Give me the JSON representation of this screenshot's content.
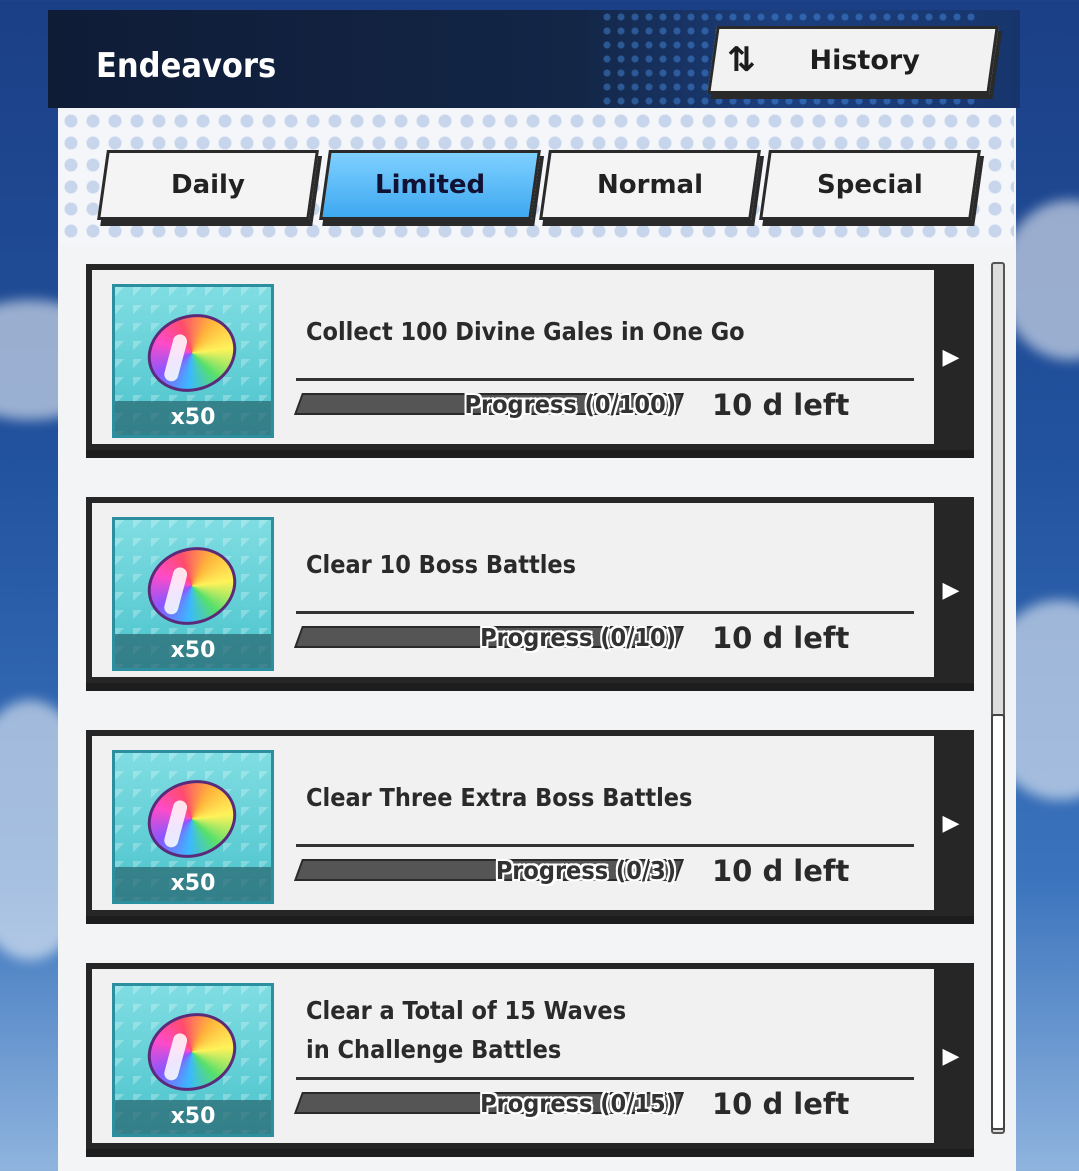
{
  "header": {
    "title": "Endeavors",
    "history_label": "History"
  },
  "tabs": [
    {
      "label": "Daily",
      "active": false
    },
    {
      "label": "Limited",
      "active": true
    },
    {
      "label": "Normal",
      "active": false
    },
    {
      "label": "Special",
      "active": false
    }
  ],
  "tasks": [
    {
      "title_lines": [
        "Collect 100 Divine Gales in One Go"
      ],
      "reward_qty": "x50",
      "progress_text": "Progress (0/100)",
      "progress": 0,
      "time_left": "10 d left"
    },
    {
      "title_lines": [
        "Clear 10 Boss Battles"
      ],
      "reward_qty": "x50",
      "progress_text": "Progress (0/10)",
      "progress": 0,
      "time_left": "10 d left"
    },
    {
      "title_lines": [
        "Clear Three Extra Boss Battles"
      ],
      "reward_qty": "x50",
      "progress_text": "Progress (0/3)",
      "progress": 0,
      "time_left": "10 d left"
    },
    {
      "title_lines": [
        "Clear a Total of 15 Waves",
        "in Challenge Battles"
      ],
      "reward_qty": "x50",
      "progress_text": "Progress (0/15)",
      "progress": 0,
      "time_left": "10 d left"
    }
  ],
  "icons": {
    "history": "swap-arrows-icon",
    "card_arrow": "chevron-right-icon",
    "reward": "rainbow-gem-icon"
  }
}
